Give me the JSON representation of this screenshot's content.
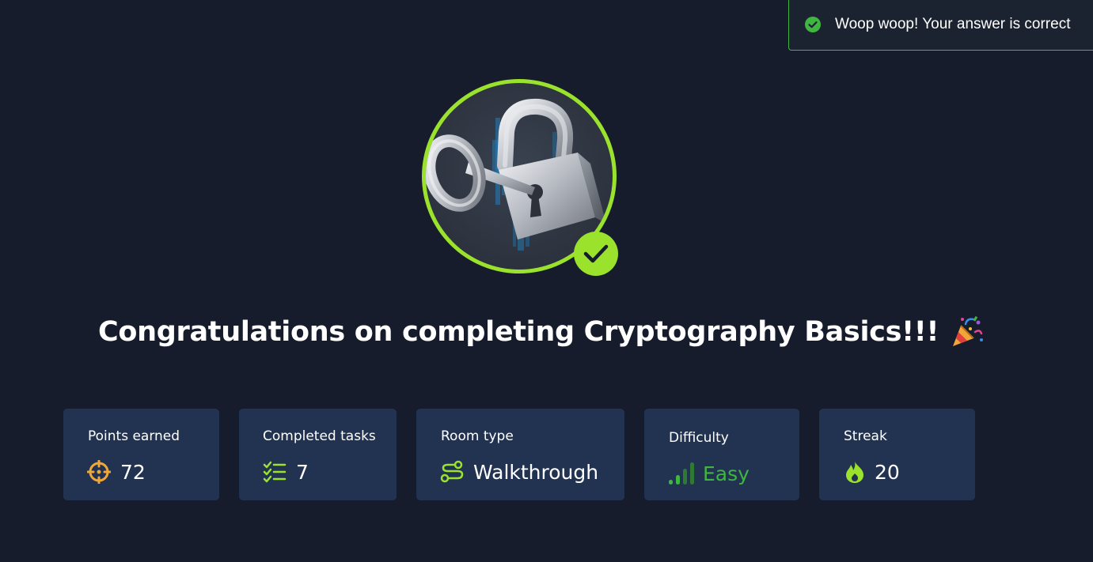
{
  "toast": {
    "message": "Woop woop! Your answer is correct",
    "icon": "check-circle-icon",
    "accent_color": "#3fb63f"
  },
  "badge": {
    "image": "padlock-with-key",
    "ring_color": "#9be22d",
    "completed_icon": "checkmark-icon"
  },
  "title": {
    "text": "Congratulations on completing Cryptography Basics!!!",
    "emoji": "party-popper-icon"
  },
  "stats": [
    {
      "label": "Points earned",
      "value": "72",
      "icon": "crosshair-icon",
      "icon_color": "#f0a73a"
    },
    {
      "label": "Completed tasks",
      "value": "7",
      "icon": "task-list-icon",
      "icon_color": "#9be22d"
    },
    {
      "label": "Room type",
      "value": "Walkthrough",
      "icon": "route-icon",
      "icon_color": "#9be22d"
    },
    {
      "label": "Difficulty",
      "value": "Easy",
      "icon": "signal-bars-icon",
      "icon_color": "#3fb63f"
    },
    {
      "label": "Streak",
      "value": "20",
      "icon": "flame-icon",
      "icon_color": "#9be22d"
    }
  ],
  "colors": {
    "background": "#161c2b",
    "card": "#223352",
    "accent_green": "#9be22d"
  }
}
